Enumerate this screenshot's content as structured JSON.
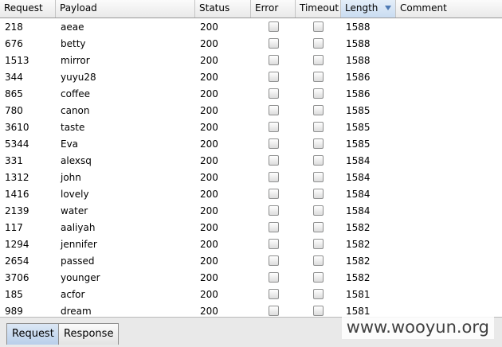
{
  "columns": [
    "Request",
    "Payload",
    "Status",
    "Error",
    "Timeout",
    "Length",
    "Comment"
  ],
  "sort": {
    "column": "Length",
    "direction": "descending"
  },
  "rows": [
    {
      "request": "218",
      "payload": "aeae",
      "status": "200",
      "error": false,
      "timeout": false,
      "length": "1588"
    },
    {
      "request": "676",
      "payload": "betty",
      "status": "200",
      "error": false,
      "timeout": false,
      "length": "1588"
    },
    {
      "request": "1513",
      "payload": "mirror",
      "status": "200",
      "error": false,
      "timeout": false,
      "length": "1588"
    },
    {
      "request": "344",
      "payload": "yuyu28",
      "status": "200",
      "error": false,
      "timeout": false,
      "length": "1586"
    },
    {
      "request": "865",
      "payload": "coffee",
      "status": "200",
      "error": false,
      "timeout": false,
      "length": "1586"
    },
    {
      "request": "780",
      "payload": "canon",
      "status": "200",
      "error": false,
      "timeout": false,
      "length": "1585"
    },
    {
      "request": "3610",
      "payload": "taste",
      "status": "200",
      "error": false,
      "timeout": false,
      "length": "1585"
    },
    {
      "request": "5344",
      "payload": "Eva",
      "status": "200",
      "error": false,
      "timeout": false,
      "length": "1585"
    },
    {
      "request": "331",
      "payload": "alexsq",
      "status": "200",
      "error": false,
      "timeout": false,
      "length": "1584"
    },
    {
      "request": "1312",
      "payload": "john",
      "status": "200",
      "error": false,
      "timeout": false,
      "length": "1584"
    },
    {
      "request": "1416",
      "payload": "lovely",
      "status": "200",
      "error": false,
      "timeout": false,
      "length": "1584"
    },
    {
      "request": "2139",
      "payload": "water",
      "status": "200",
      "error": false,
      "timeout": false,
      "length": "1584"
    },
    {
      "request": "117",
      "payload": "aaliyah",
      "status": "200",
      "error": false,
      "timeout": false,
      "length": "1582"
    },
    {
      "request": "1294",
      "payload": "jennifer",
      "status": "200",
      "error": false,
      "timeout": false,
      "length": "1582"
    },
    {
      "request": "2654",
      "payload": "passed",
      "status": "200",
      "error": false,
      "timeout": false,
      "length": "1582"
    },
    {
      "request": "3706",
      "payload": "younger",
      "status": "200",
      "error": false,
      "timeout": false,
      "length": "1582"
    },
    {
      "request": "185",
      "payload": "acfor",
      "status": "200",
      "error": false,
      "timeout": false,
      "length": "1581"
    },
    {
      "request": "989",
      "payload": "dream",
      "status": "200",
      "error": false,
      "timeout": false,
      "length": "1581"
    }
  ],
  "tabs": [
    {
      "label": "Request",
      "active": true
    },
    {
      "label": "Response",
      "active": false
    }
  ],
  "watermark": "www.wooyun.org"
}
